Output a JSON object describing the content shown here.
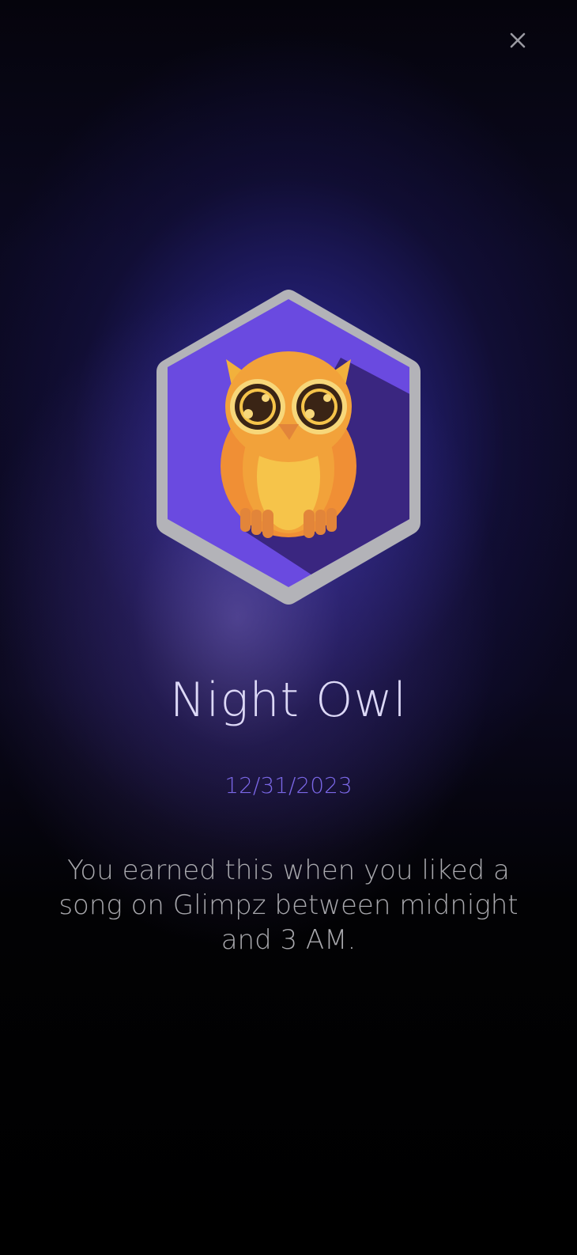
{
  "header": {
    "close_icon": "close-icon"
  },
  "badge": {
    "icon": "night-owl-badge-icon",
    "title": "Night Owl",
    "date": "12/31/2023",
    "description": "You earned this when you liked a song on Glimpz between midnight and 3 AM."
  },
  "colors": {
    "badge_frame": "#b6b6ba",
    "badge_fill": "#6a4ae0",
    "badge_shadow": "#3a2680",
    "owl_body": "#f2a23a",
    "date_accent": "#7a67e6"
  }
}
